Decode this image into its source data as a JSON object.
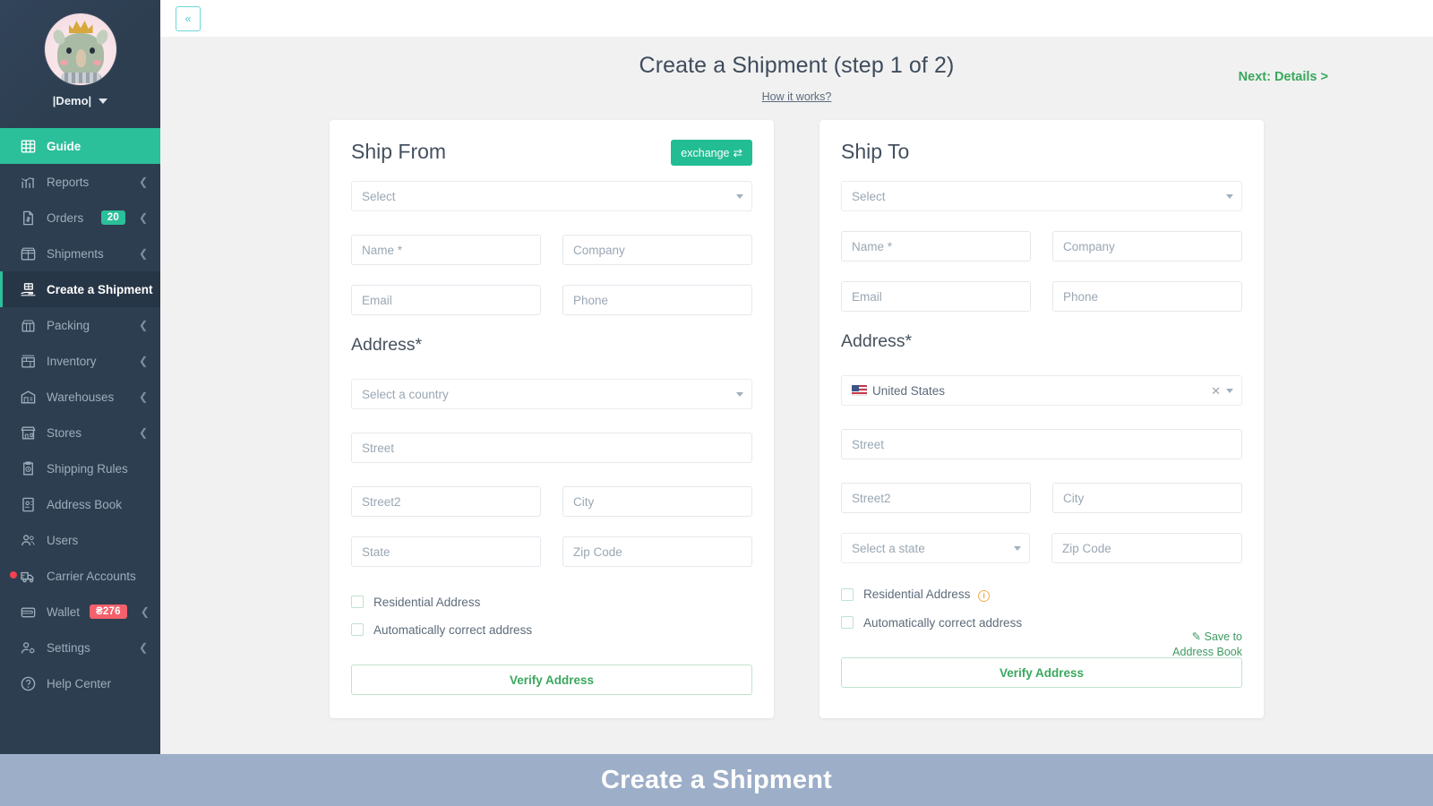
{
  "sidebar": {
    "profile": {
      "name": "|Demo|",
      "avatar_icon": "rhino-avatar-icon",
      "caret_icon": "chevron-down-icon"
    },
    "items": [
      {
        "label": "Guide",
        "icon": "grid-icon",
        "state": "active-green",
        "badge": null,
        "chevron": false
      },
      {
        "label": "Reports",
        "icon": "bar-chart-icon",
        "state": "",
        "badge": null,
        "chevron": true
      },
      {
        "label": "Orders",
        "icon": "invoice-icon",
        "state": "",
        "badge": "20",
        "badge_color": "teal",
        "chevron": true
      },
      {
        "label": "Shipments",
        "icon": "package-icon",
        "state": "",
        "badge": null,
        "chevron": true
      },
      {
        "label": "Create a Shipment",
        "icon": "ship-hand-icon",
        "state": "active-dark",
        "badge": null,
        "chevron": false
      },
      {
        "label": "Packing",
        "icon": "open-box-icon",
        "state": "",
        "badge": null,
        "chevron": true
      },
      {
        "label": "Inventory",
        "icon": "inventory-icon",
        "state": "",
        "badge": null,
        "chevron": true
      },
      {
        "label": "Warehouses",
        "icon": "warehouse-icon",
        "state": "",
        "badge": null,
        "chevron": true
      },
      {
        "label": "Stores",
        "icon": "store-icon",
        "state": "",
        "badge": null,
        "chevron": true
      },
      {
        "label": "Shipping Rules",
        "icon": "clipboard-clock-icon",
        "state": "",
        "badge": null,
        "chevron": false
      },
      {
        "label": "Address Book",
        "icon": "contact-card-icon",
        "state": "",
        "badge": null,
        "chevron": false
      },
      {
        "label": "Users",
        "icon": "users-icon",
        "state": "",
        "badge": null,
        "chevron": false
      },
      {
        "label": "Carrier Accounts",
        "icon": "truck-icon",
        "state": "",
        "badge": null,
        "chevron": false,
        "alert_dot": true
      },
      {
        "label": "Wallet",
        "icon": "wallet-icon",
        "state": "",
        "badge": "₴276",
        "badge_color": "red",
        "chevron": true
      },
      {
        "label": "Settings",
        "icon": "user-gear-icon",
        "state": "",
        "badge": null,
        "chevron": true
      },
      {
        "label": "Help Center",
        "icon": "question-circle-icon",
        "state": "",
        "badge": null,
        "chevron": false
      }
    ]
  },
  "topbar": {
    "collapse_label": "«",
    "collapse_icon": "double-chevron-left-icon"
  },
  "header": {
    "title": "Create a Shipment (step 1 of 2)",
    "how_it_works": "How it works?",
    "next_link": "Next: Details >"
  },
  "ship_from": {
    "title": "Ship From",
    "exchange_label": "exchange",
    "exchange_icon": "swap-arrows-icon",
    "preset_select": {
      "value": "Select",
      "caret_icon": "chevron-down-icon"
    },
    "name_placeholder": "Name *",
    "company_placeholder": "Company",
    "email_placeholder": "Email",
    "phone_placeholder": "Phone",
    "address_title": "Address*",
    "country_select": {
      "value": "Select a country",
      "caret_icon": "chevron-down-icon"
    },
    "street_placeholder": "Street",
    "street2_placeholder": "Street2",
    "city_placeholder": "City",
    "state_placeholder": "State",
    "zip_placeholder": "Zip Code",
    "residential_label": "Residential Address",
    "autocorrect_label": "Automatically correct address",
    "verify_label": "Verify Address"
  },
  "ship_to": {
    "title": "Ship To",
    "preset_select": {
      "value": "Select",
      "caret_icon": "chevron-down-icon"
    },
    "name_placeholder": "Name *",
    "company_placeholder": "Company",
    "email_placeholder": "Email",
    "phone_placeholder": "Phone",
    "address_title": "Address*",
    "country_select": {
      "value": "United States",
      "flag_icon": "us-flag-icon",
      "clear_icon": "clear-x-icon",
      "caret_icon": "chevron-down-icon"
    },
    "street_placeholder": "Street",
    "street2_placeholder": "Street2",
    "city_placeholder": "City",
    "state_select": {
      "value": "Select a state",
      "caret_icon": "chevron-down-icon"
    },
    "zip_placeholder": "Zip Code",
    "residential_label": "Residential Address",
    "residential_info_icon": "info-circle-icon",
    "autocorrect_label": "Automatically correct address",
    "save_address_book": {
      "line1": "Save to",
      "line2": "Address Book",
      "icon": "edit-square-icon"
    },
    "verify_label": "Verify Address"
  },
  "bottom_overlay": {
    "text": "Create a Shipment"
  },
  "colors": {
    "sidebar_bg": "#2d3e50",
    "accent_green": "#2bbf9a",
    "link_green": "#3aa85e",
    "badge_red": "#f4606c",
    "overlay_blue": "#9caec8",
    "page_bg": "#f1f1f1"
  }
}
